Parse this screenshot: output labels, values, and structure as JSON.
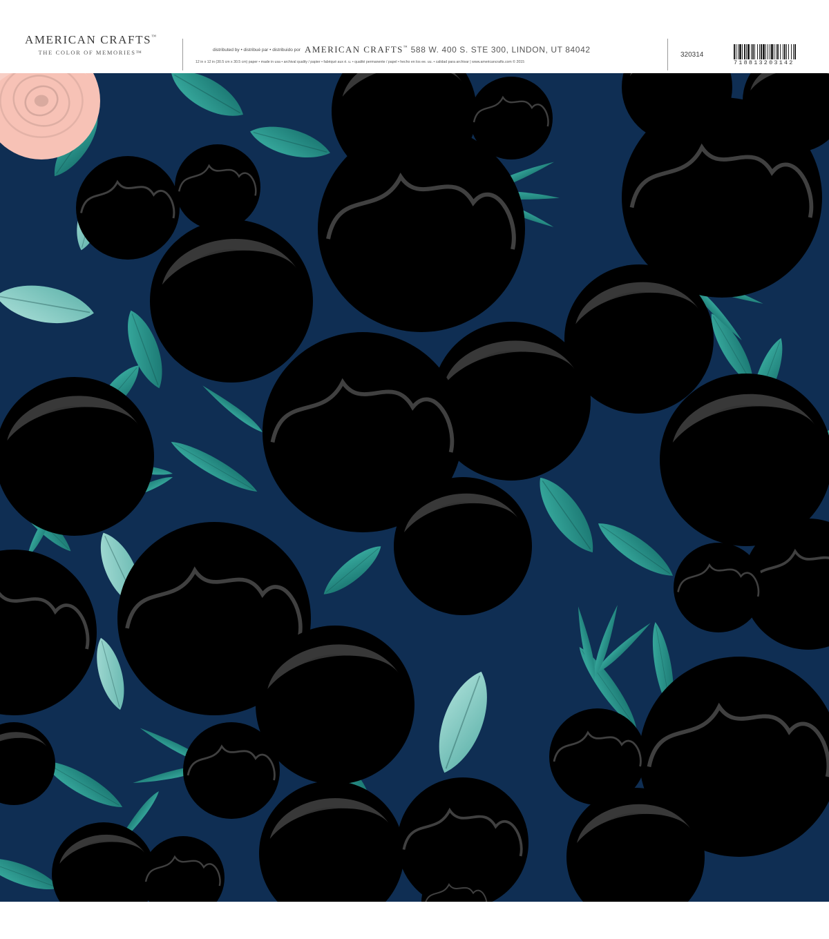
{
  "header": {
    "brand_name": "AMERICAN CRAFTS",
    "brand_tm": "™",
    "brand_tagline": "THE COLOR OF MEMORIES™",
    "distributed_label": "distributed by • distribué par • distribuido por",
    "distributor_name": "AMERICAN CRAFTS",
    "distributor_tm": "™",
    "distributor_address": "588 W. 400 S. STE 300, LINDON, UT 84042",
    "fine_print": "12 in x 12 in (30.5 cm x 30.5 cm) paper • made in usa • archival quality / papier • fabriqué aux é. u. • qualité permanente / papel • hecho en los ee. uu. • calidad para archivar | www.americancrafts.com © 2015",
    "sku": "320314",
    "barcode_digits": "718813203142"
  },
  "paper": {
    "background_color": "#0f2e53",
    "leaf_colors": [
      "#2f9f94",
      "#1e8078",
      "#8fd0c8"
    ],
    "flower_colors": {
      "blush_rose": "#f7c7bf",
      "peach_peony": "#f2937f",
      "pink_peony": "#e07fa6",
      "magenta_bud": "#a62e6c",
      "plum_bud": "#7a1f45",
      "light_rose": "#fbd9d2"
    }
  }
}
